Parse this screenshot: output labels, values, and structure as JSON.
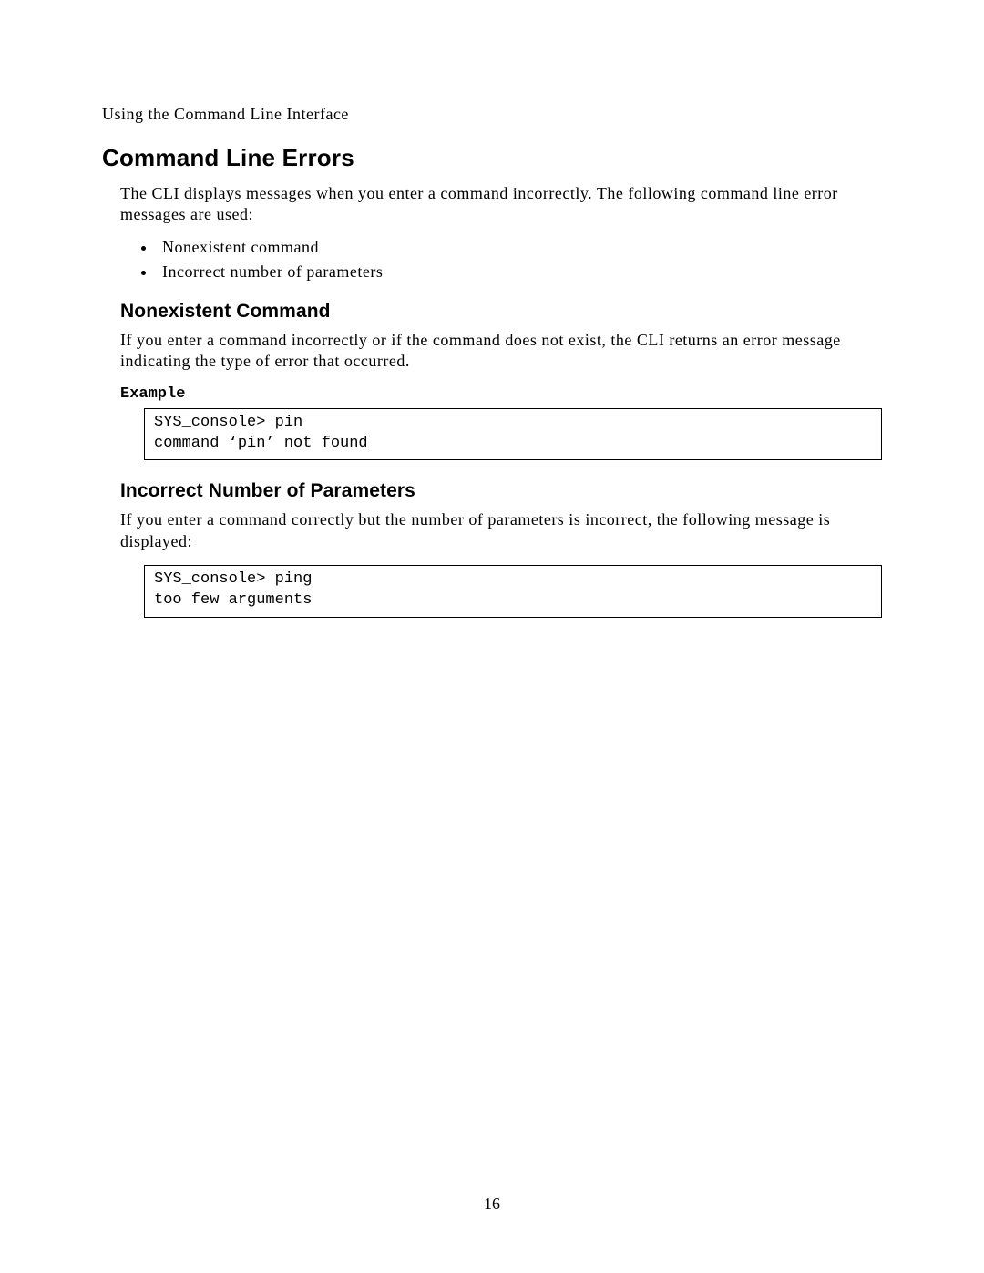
{
  "header": {
    "running_head": "Using the Command Line Interface"
  },
  "section": {
    "title": "Command Line Errors",
    "intro": "The CLI displays messages when you enter a command incorrectly.  The following command line error messages are used:",
    "bullets": [
      "Nonexistent command",
      "Incorrect number of parameters"
    ]
  },
  "sub1": {
    "title": "Nonexistent Command",
    "body": "If you enter a command incorrectly or if the command does not exist, the CLI returns an error message indicating the type of error that occurred.",
    "example_label": "Example",
    "code": "SYS_console> pin\ncommand ‘pin’ not found"
  },
  "sub2": {
    "title": "Incorrect Number of Parameters",
    "body": "If you enter a command correctly but the number of parameters is incorrect, the following message is displayed:",
    "code": "SYS_console> ping\ntoo few arguments"
  },
  "footer": {
    "page_number": "16"
  }
}
